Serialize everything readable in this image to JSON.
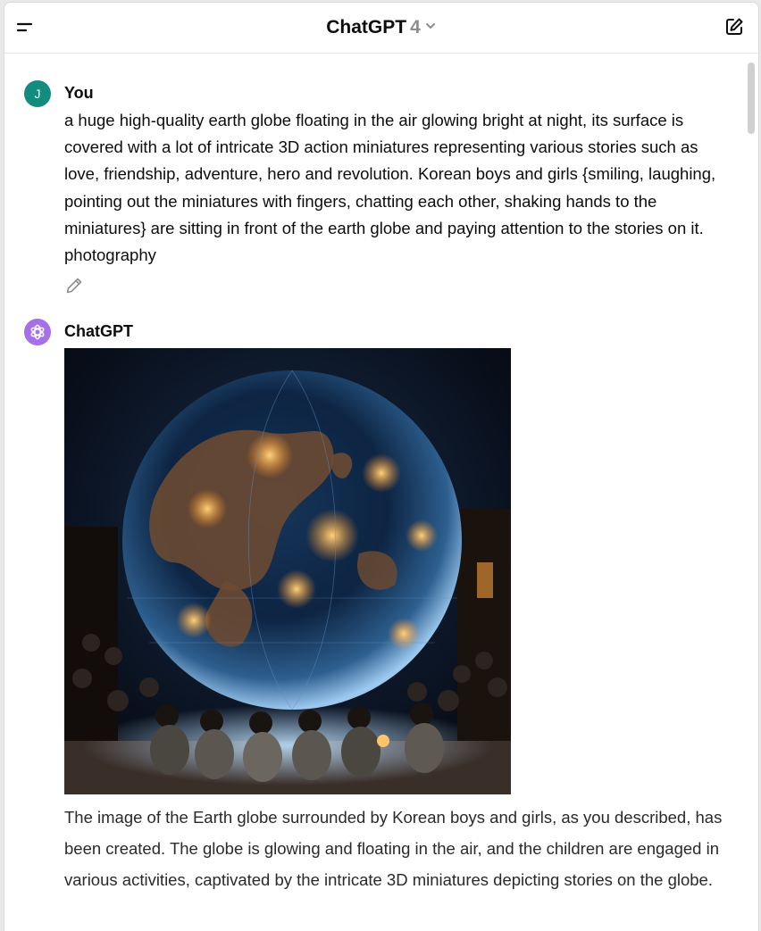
{
  "header": {
    "title": "ChatGPT",
    "version": "4",
    "menu_icon": "sidebar-menu-icon",
    "edit_icon": "new-chat-icon"
  },
  "messages": {
    "user": {
      "avatar_letter": "J",
      "author": "You",
      "text": "a huge high-quality earth globe floating in the air glowing bright at night, its surface is covered with a lot of intricate 3D action miniatures representing various stories such as love, friendship, adventure, hero and revolution. Korean boys and girls {smiling, laughing, pointing out the miniatures with fingers, chatting each other, shaking hands to the miniatures} are sitting in front of the earth globe and paying attention to the stories on it. photography",
      "edit_icon": "pencil-icon"
    },
    "assistant": {
      "author": "ChatGPT",
      "image_alt": "glowing earth globe with miniatures surrounded by children",
      "text": "The image of the Earth globe surrounded by Korean boys and girls, as you described, has been created. The globe is glowing and floating in the air, and the children are engaged in various activities, captivated by the intricate 3D miniatures depicting stories on the globe."
    }
  },
  "colors": {
    "user_avatar": "#128c7e",
    "assistant_avatar": "#a770e8"
  }
}
